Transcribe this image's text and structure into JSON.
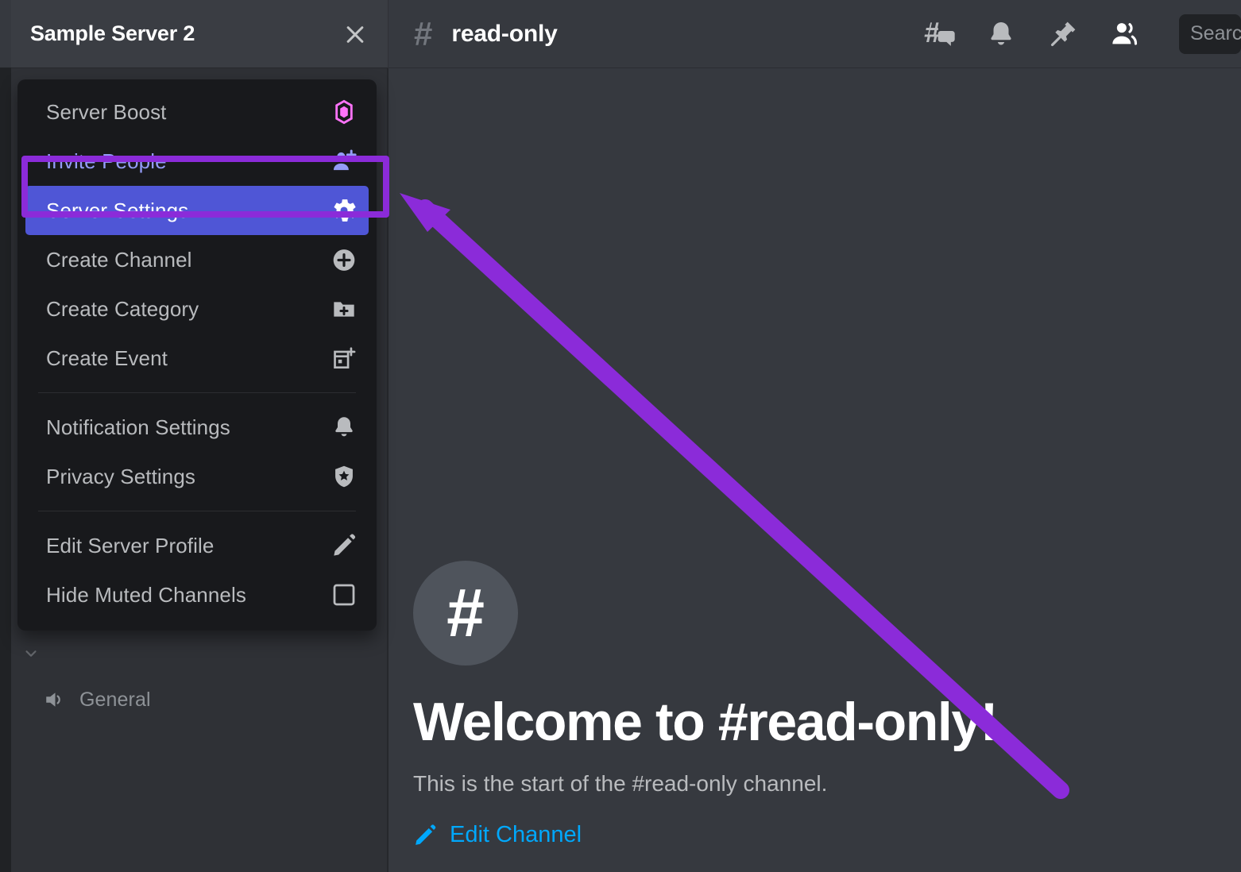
{
  "sidebar": {
    "server_name": "Sample Server 2",
    "close_icon": "close-icon",
    "voice_channel": {
      "label": "General",
      "icon": "speaker-icon"
    }
  },
  "context_menu": {
    "items": [
      {
        "label": "Server Boost",
        "icon": "boost-diamond-icon",
        "state": "normal"
      },
      {
        "label": "Invite People",
        "icon": "person-add-icon",
        "state": "annotated"
      },
      {
        "label": "Server Settings",
        "icon": "gear-icon",
        "state": "selected"
      },
      {
        "label": "Create Channel",
        "icon": "plus-circle-icon",
        "state": "normal"
      },
      {
        "label": "Create Category",
        "icon": "folder-plus-icon",
        "state": "normal"
      },
      {
        "label": "Create Event",
        "icon": "calendar-plus-icon",
        "state": "normal"
      },
      {
        "label": "Notification Settings",
        "icon": "bell-icon",
        "state": "normal"
      },
      {
        "label": "Privacy Settings",
        "icon": "shield-star-icon",
        "state": "normal"
      },
      {
        "label": "Edit Server Profile",
        "icon": "pencil-icon",
        "state": "normal"
      },
      {
        "label": "Hide Muted Channels",
        "icon": "checkbox-icon",
        "state": "normal"
      }
    ]
  },
  "channel_header": {
    "hash": "#",
    "name": "read-only",
    "icons": [
      "threads-icon",
      "bell-icon",
      "pin-icon",
      "members-icon"
    ],
    "search_placeholder": "Search"
  },
  "welcome": {
    "hash": "#",
    "title": "Welcome to #read-only!",
    "subtitle": "This is the start of the #read-only channel.",
    "edit_link": "Edit Channel"
  },
  "annotation": {
    "highlight_color": "#8b2bd9",
    "arrow_color": "#8b2bd9"
  },
  "colors": {
    "sidebar_bg": "#2f3136",
    "menu_bg": "#18191c",
    "selected_bg": "#4f56d6",
    "main_bg": "#36393f",
    "link_blue": "#00a8fc",
    "invite_text": "#949cf7",
    "boost_pink": "#ff73fa"
  }
}
